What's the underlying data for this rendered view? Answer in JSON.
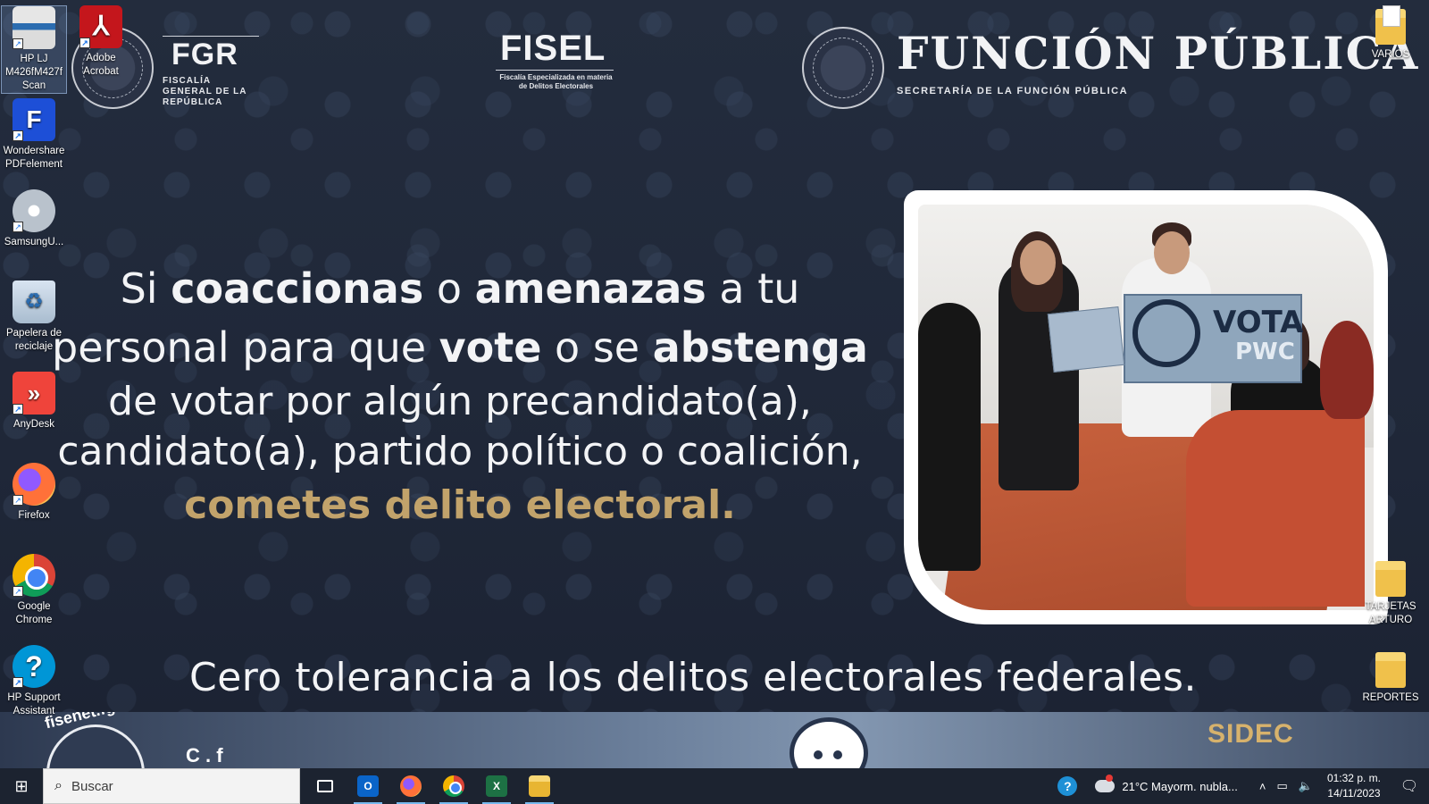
{
  "header": {
    "fgr": {
      "title": "FGR",
      "subtitle": "FISCALÍA GENERAL DE LA REPÚBLICA"
    },
    "fisel": {
      "title": "FISEL",
      "subtitle": "Fiscalía Especializada en materia de Delitos Electorales"
    },
    "funcion_publica": {
      "title": "FUNCIÓN PÚBLICA",
      "subtitle": "SECRETARÍA DE LA FUNCIÓN PÚBLICA"
    }
  },
  "message": {
    "l1_a": "Si ",
    "l1_b": "coaccionas",
    "l1_c": " o ",
    "l1_d": "amenazas",
    "l1_e": " a tu",
    "l2_a": "personal para que ",
    "l2_b": "vote",
    "l2_c": " o se ",
    "l2_d": "abstenga",
    "l3": "de votar por algún precandidato(a),",
    "l4": "candidato(a), partido político o coalición,",
    "l5": "cometes delito electoral."
  },
  "photo": {
    "sign_text_1": "VOTA",
    "sign_text_2": "PWC"
  },
  "tagline": "Cero tolerancia a los delitos electorales federales.",
  "banner": {
    "url": "fisenet.fgr.org.mx",
    "partial_text": "C  .  f",
    "sidec": "SIDEC"
  },
  "desktop_icons": [
    {
      "label": "HP LJ M426fM427f Scan",
      "icon": "scanner-icon"
    },
    {
      "label": "Adobe Acrobat",
      "icon": "acrobat-icon"
    },
    {
      "label": "Wondershare PDFelement",
      "icon": "pdfelement-icon"
    },
    {
      "label": "SamsungU...",
      "icon": "samsung-disc-icon"
    },
    {
      "label": "Papelera de reciclaje",
      "icon": "recycle-bin-icon"
    },
    {
      "label": "AnyDesk",
      "icon": "anydesk-icon"
    },
    {
      "label": "Firefox",
      "icon": "firefox-icon"
    },
    {
      "label": "Google Chrome",
      "icon": "chrome-icon"
    },
    {
      "label": "HP Support Assistant",
      "icon": "hp-support-icon"
    },
    {
      "label": "VARIOS",
      "icon": "folder-icon"
    },
    {
      "label": "TARJETAS ARTURO",
      "icon": "folder-icon"
    },
    {
      "label": "REPORTES",
      "icon": "folder-icon"
    }
  ],
  "taskbar": {
    "search_placeholder": "Buscar",
    "apps": [
      "task-view",
      "outlook",
      "firefox",
      "chrome",
      "excel",
      "file-explorer"
    ],
    "weather": "21°C  Mayorm. nubla...",
    "time": "01:32 p. m.",
    "date": "14/11/2023"
  },
  "colors": {
    "accent_gold": "#c2a36b",
    "background": "#1e2636",
    "taskbar": "#1c2330"
  }
}
